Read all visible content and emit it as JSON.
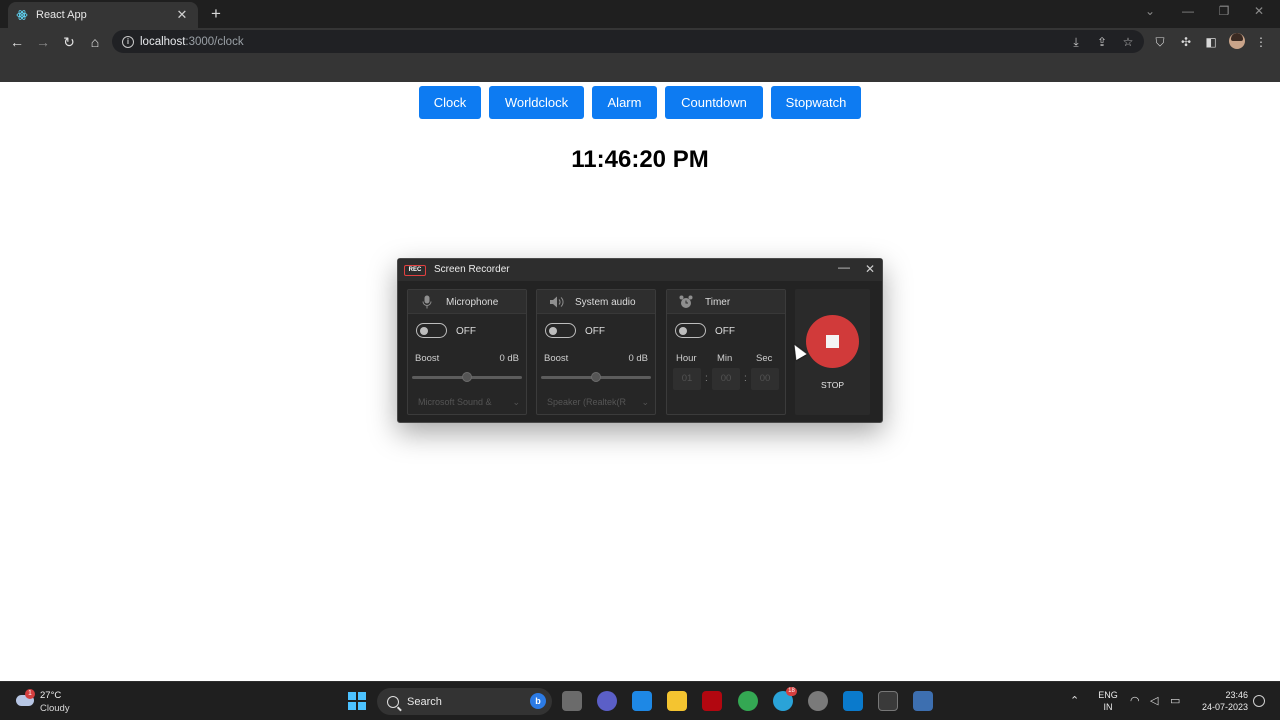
{
  "browser": {
    "tab_title": "React App",
    "tab_close": "✕",
    "new_tab": "+",
    "url_host": "localhost",
    "url_path": ":3000/clock"
  },
  "app": {
    "nav": [
      "Clock",
      "Worldclock",
      "Alarm",
      "Countdown",
      "Stopwatch"
    ],
    "time": "11:46:20 PM"
  },
  "recorder": {
    "logo": "REC",
    "title": "Screen Recorder",
    "microphone": {
      "label": "Microphone",
      "toggle": "OFF",
      "boost_label": "Boost",
      "boost_value": "0 dB",
      "boost_level": 0.5,
      "device": "Microsoft Sound &"
    },
    "system_audio": {
      "label": "System audio",
      "toggle": "OFF",
      "boost_label": "Boost",
      "boost_value": "0 dB",
      "boost_level": 0.5,
      "device": "Speaker (Realtek(R"
    },
    "timer": {
      "label": "Timer",
      "toggle": "OFF",
      "hour_label": "Hour",
      "min_label": "Min",
      "sec_label": "Sec",
      "hour": "01",
      "min": "00",
      "sec": "00",
      "separator": ":"
    },
    "stop_label": "STOP"
  },
  "taskbar": {
    "weather_temp": "27°C",
    "weather_condition": "Cloudy",
    "weather_badge": "1",
    "search_placeholder": "Search",
    "bing": "b",
    "telegram_badge": "18",
    "lang_top": "ENG",
    "lang_bottom": "IN",
    "time": "23:46",
    "date": "24-07-2023"
  }
}
